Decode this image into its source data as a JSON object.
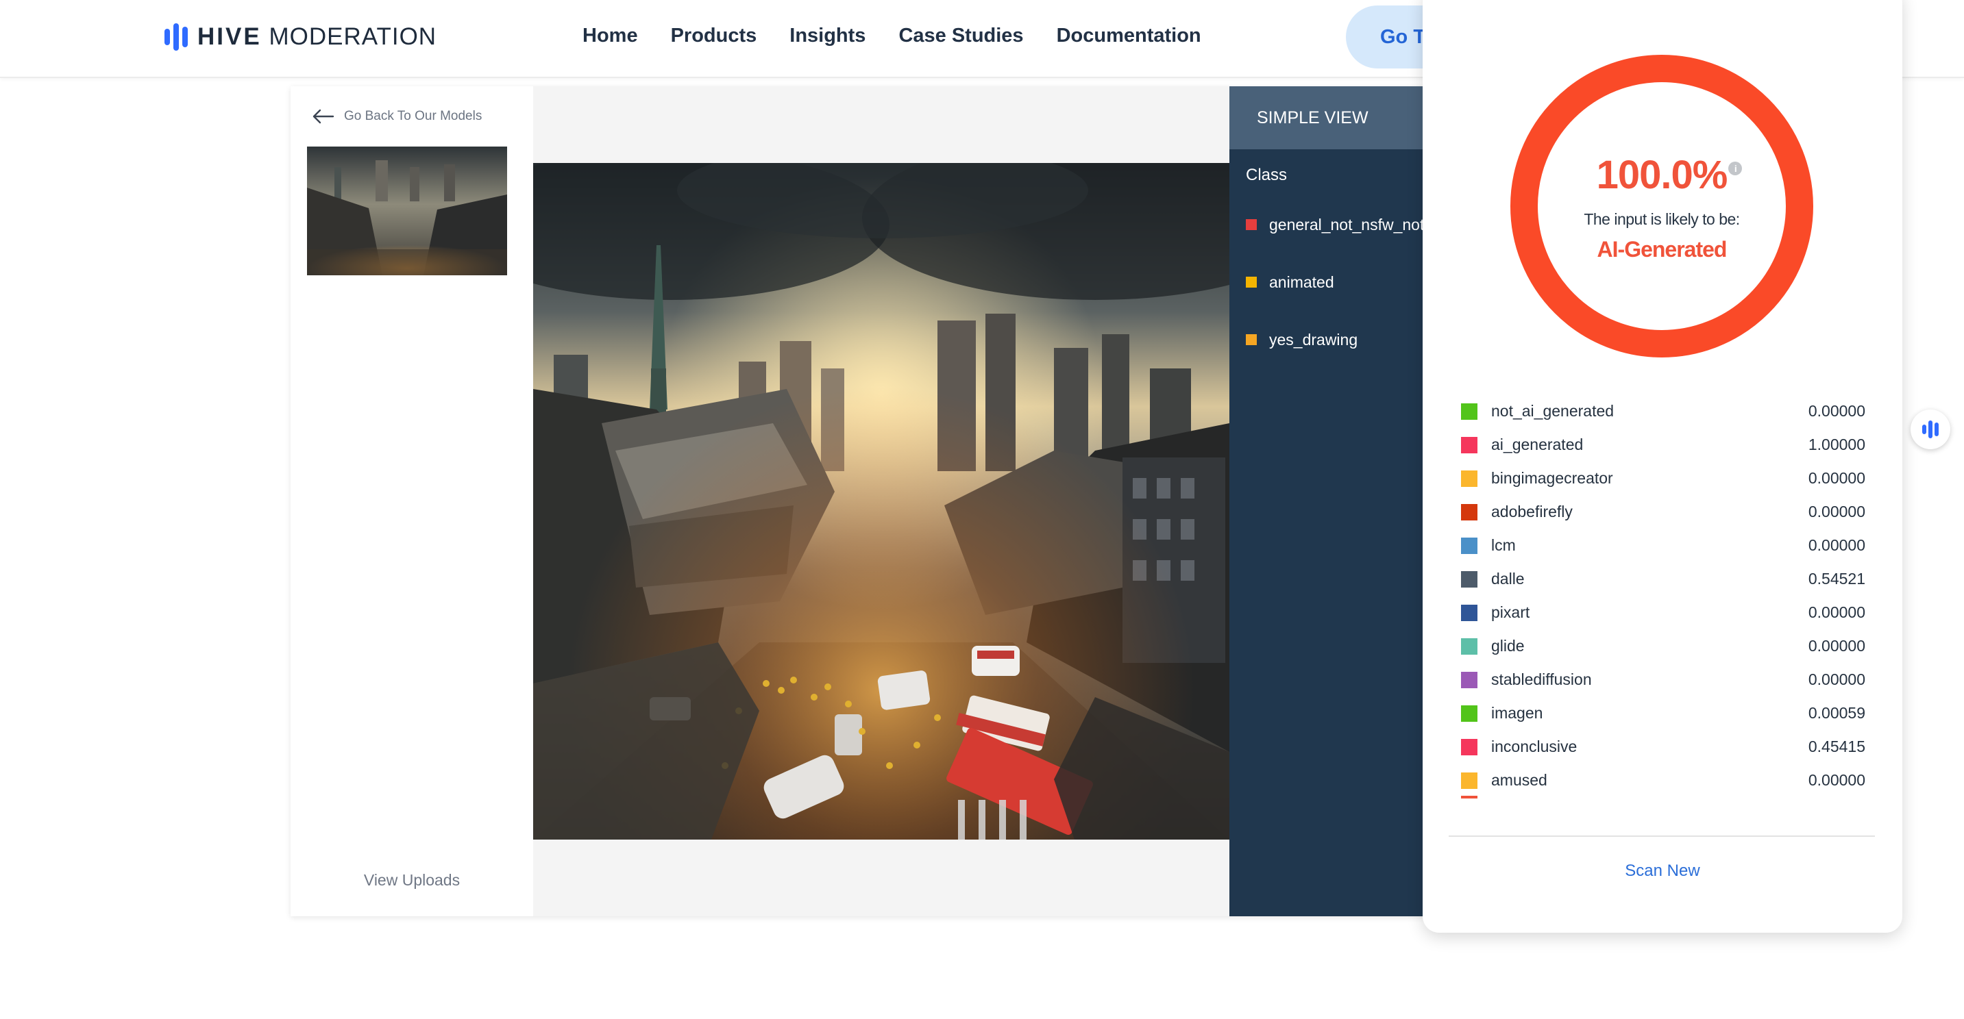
{
  "header": {
    "logo_bold": "HIVE",
    "logo_light": "MODERATION",
    "nav": [
      "Home",
      "Products",
      "Insights",
      "Case Studies",
      "Documentation"
    ],
    "cta": "Go To"
  },
  "sidebar": {
    "back_link": "Go Back To Our Models",
    "view_uploads": "View Uploads"
  },
  "simple_view": {
    "title": "SIMPLE VIEW",
    "class_header": "Class",
    "classes": [
      {
        "label": "general_not_nsfw_not_suggestive",
        "color": "#e53e3e"
      },
      {
        "label": "animated",
        "color": "#f4b400"
      },
      {
        "label": "yes_drawing",
        "color": "#f5a623"
      }
    ]
  },
  "result": {
    "percent": "100.0%",
    "info_icon": "info-icon",
    "likely_text": "The input is likely to be:",
    "verdict": "AI-Generated",
    "ring_fraction": 1.0,
    "accent_color": "#fa4a28",
    "scores": [
      {
        "name": "not_ai_generated",
        "value": "0.00000",
        "color": "#52c41a"
      },
      {
        "name": "ai_generated",
        "value": "1.00000",
        "color": "#f5365c"
      },
      {
        "name": "bingimagecreator",
        "value": "0.00000",
        "color": "#fbb62d"
      },
      {
        "name": "adobefirefly",
        "value": "0.00000",
        "color": "#d4380d"
      },
      {
        "name": "lcm",
        "value": "0.00000",
        "color": "#4a90c8"
      },
      {
        "name": "dalle",
        "value": "0.54521",
        "color": "#4d5b6a"
      },
      {
        "name": "pixart",
        "value": "0.00000",
        "color": "#2f5597"
      },
      {
        "name": "glide",
        "value": "0.00000",
        "color": "#5dbfa8"
      },
      {
        "name": "stablediffusion",
        "value": "0.00000",
        "color": "#9b59b6"
      },
      {
        "name": "imagen",
        "value": "0.00059",
        "color": "#52c41a"
      },
      {
        "name": "inconclusive",
        "value": "0.45415",
        "color": "#f5365c"
      },
      {
        "name": "amused",
        "value": "0.00000",
        "color": "#fbb62d"
      }
    ],
    "scan_new": "Scan New"
  }
}
